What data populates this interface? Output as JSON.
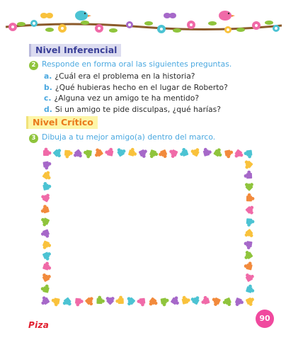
{
  "section1": {
    "heading": "Nivel Inferencial",
    "number": "2",
    "instruction": "Responde en forma oral las siguientes preguntas.",
    "questions": [
      {
        "letter": "a.",
        "text": "¿Cuál era el problema en la historia?"
      },
      {
        "letter": "b.",
        "text": "¿Qué hubieras hecho en el lugar de Roberto?"
      },
      {
        "letter": "c.",
        "text": "¿Alguna vez un amigo te ha mentido?"
      },
      {
        "letter": "d.",
        "text": "Si un amigo te pide disculpas, ¿qué harías?"
      }
    ]
  },
  "section2": {
    "heading": "Nivel Crítico",
    "number": "3",
    "instruction": "Dibuja a tu mejor amigo(a) dentro del marco."
  },
  "footer": {
    "page_number": "90",
    "logo": "Piza"
  },
  "colors": {
    "heading1_text": "#3a3f98",
    "heading2_text": "#e97a1c",
    "instruction_text": "#4aa8e0",
    "number_badge": "#8fc43c",
    "page_badge": "#f0499e",
    "puzzle_pieces": [
      "#f06aa8",
      "#4cc3d3",
      "#f9c23c",
      "#a668c9",
      "#8fc43c",
      "#f28a3c"
    ]
  }
}
